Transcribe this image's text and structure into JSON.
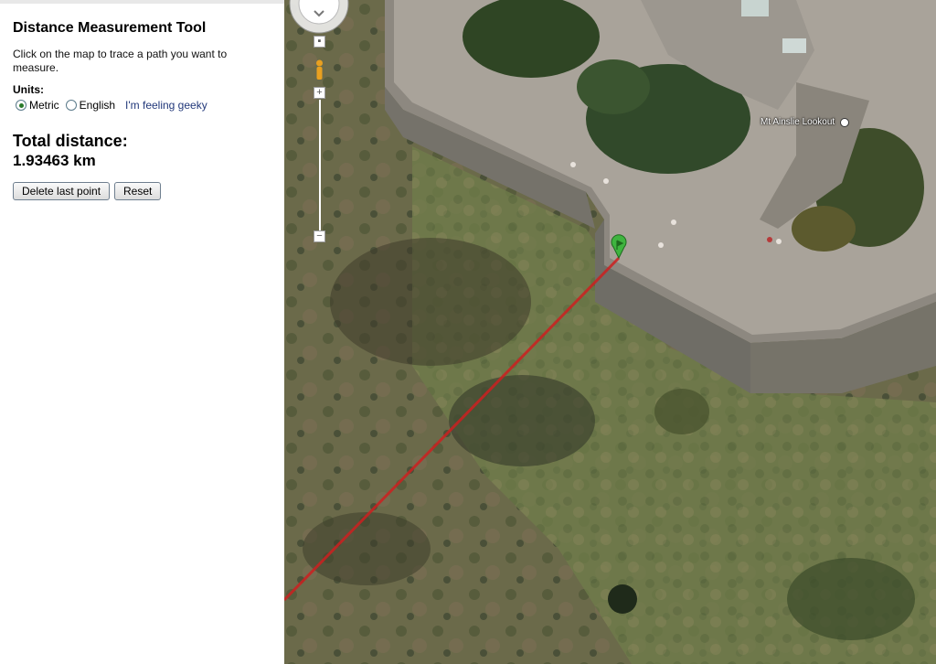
{
  "panel": {
    "title": "Distance Measurement Tool",
    "instructions": "Click on the map to trace a path you want to measure.",
    "units_label": "Units:",
    "unit_metric": "Metric",
    "unit_english": "English",
    "geeky_link": "I'm feeling geeky",
    "selected_unit": "Metric",
    "total_label": "Total distance:",
    "total_value": "1.93463 km",
    "delete_button": "Delete last point",
    "reset_button": "Reset"
  },
  "map": {
    "place_label": "Mt Ainslie Lookout",
    "path_color": "#cc2020",
    "marker_color": "#3fb43f",
    "zoom_in": "+",
    "zoom_out": "−"
  }
}
